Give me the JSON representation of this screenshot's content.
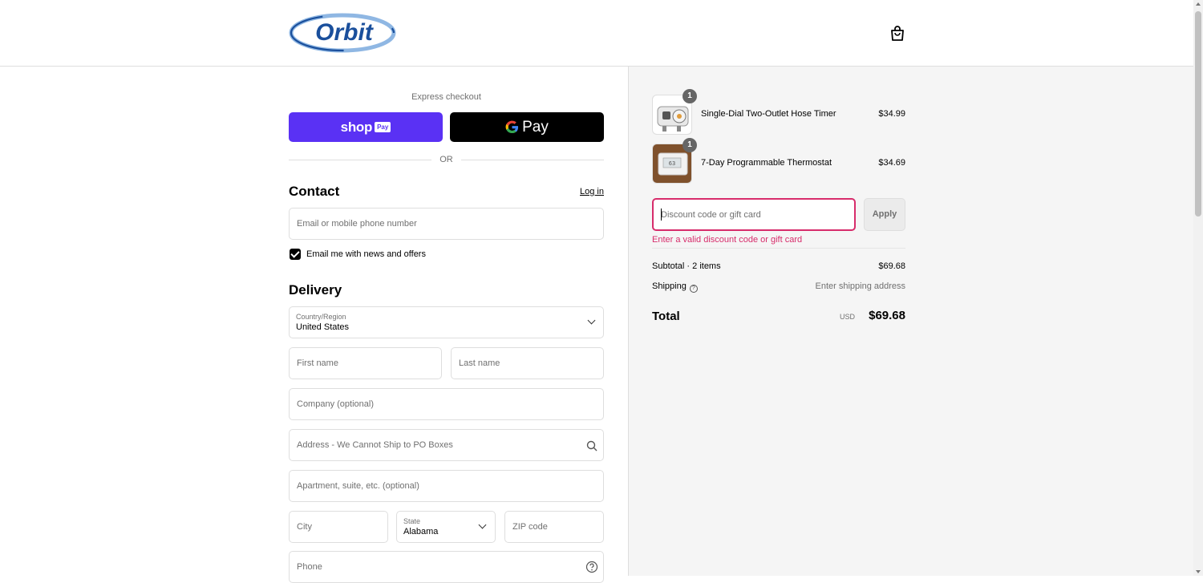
{
  "header": {
    "logo_text": "Orbit",
    "cart_icon": "shopping-bag-icon"
  },
  "express": {
    "label": "Express checkout",
    "shop_pay": {
      "shop": "shop",
      "pay": "Pay"
    },
    "google_pay": {
      "pay": "Pay"
    },
    "or": "OR"
  },
  "contact": {
    "title": "Contact",
    "login": "Log in",
    "email_placeholder": "Email or mobile phone number",
    "newsletter_label": "Email me with news and offers",
    "newsletter_checked": true
  },
  "delivery": {
    "title": "Delivery",
    "country_label": "Country/Region",
    "country_value": "United States",
    "first_name_placeholder": "First name",
    "last_name_placeholder": "Last name",
    "company_placeholder": "Company (optional)",
    "address_placeholder": "Address - We Cannot Ship to PO Boxes",
    "apartment_placeholder": "Apartment, suite, etc. (optional)",
    "city_placeholder": "City",
    "state_label": "State",
    "state_value": "Alabama",
    "zip_placeholder": "ZIP code",
    "phone_placeholder": "Phone"
  },
  "order": {
    "items": [
      {
        "name": "Single-Dial Two-Outlet Hose Timer",
        "price": "$34.99",
        "qty": "1"
      },
      {
        "name": "7-Day Programmable Thermostat",
        "price": "$34.69",
        "qty": "1"
      }
    ],
    "discount_placeholder": "Discount code or gift card",
    "apply_label": "Apply",
    "discount_error": "Enter a valid discount code or gift card",
    "subtotal_label": "Subtotal · 2 items",
    "subtotal_value": "$69.68",
    "shipping_label": "Shipping",
    "shipping_value": "Enter shipping address",
    "total_label": "Total",
    "currency": "USD",
    "total_value": "$69.68"
  },
  "colors": {
    "shop_pay": "#5a31f4",
    "error": "#d72c6b",
    "orbit_blue": "#1a4f9c"
  }
}
